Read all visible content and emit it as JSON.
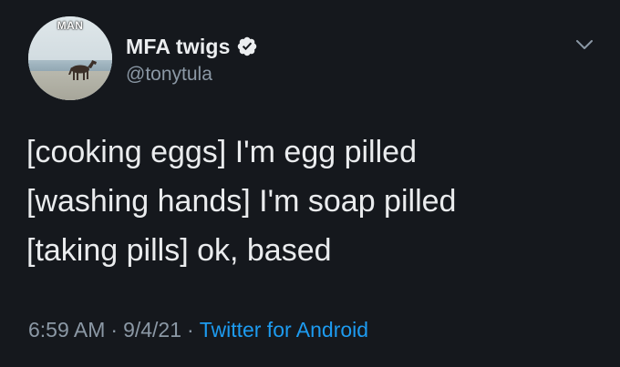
{
  "tweet": {
    "avatar": {
      "caption": "MAN",
      "description": "horse-on-beach-avatar"
    },
    "author": {
      "display_name": "MFA twigs",
      "handle": "@tonytula",
      "verified": true
    },
    "lines": [
      "[cooking eggs] I'm egg pilled",
      "[washing hands] I'm soap pilled",
      "[taking pills] ok, based"
    ],
    "meta": {
      "time": "6:59 AM",
      "separator": "·",
      "date": "9/4/21",
      "source": "Twitter for Android"
    },
    "colors": {
      "background": "#15181d",
      "accent": "#1d9bf0",
      "secondary_text": "#8b98a5"
    }
  }
}
